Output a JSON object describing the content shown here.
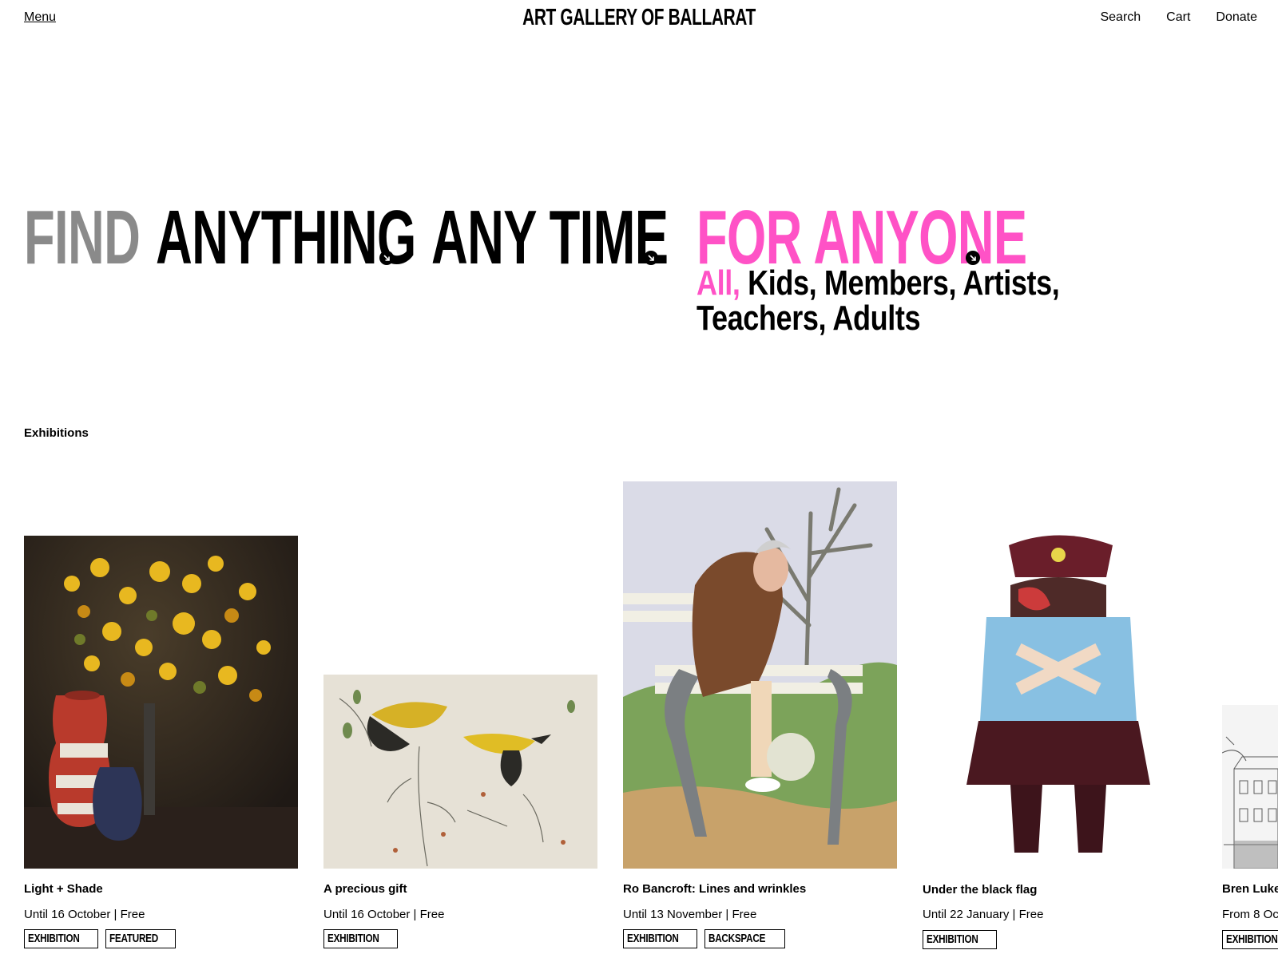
{
  "header": {
    "menu_label": "Menu",
    "site_title": "ART GALLERY OF BALLARAT",
    "nav": [
      "Search",
      "Cart",
      "Donate"
    ]
  },
  "hero": {
    "find": "FIND",
    "anything": "ANYTHING",
    "any_time": "ANY TIME",
    "for_anyone": "FOR ANYONE",
    "audiences": [
      "All,",
      "Kids,",
      "Members,",
      "Artists,",
      "Teachers,",
      "Adults"
    ],
    "accent_color": "#ff52c6",
    "muted_color": "#8a8a8a"
  },
  "exhibitions": {
    "section_label": "Exhibitions",
    "cards": [
      {
        "title": "Light + Shade",
        "meta": "Until 16 October | Free",
        "tags": [
          "EXHIBITION",
          "FEATURED"
        ]
      },
      {
        "title": "A precious gift",
        "meta": "Until 16 October | Free",
        "tags": [
          "EXHIBITION"
        ]
      },
      {
        "title": "Ro Bancroft: Lines and wrinkles",
        "meta": "Until 13 November | Free",
        "tags": [
          "EXHIBITION",
          "BACKSPACE"
        ]
      },
      {
        "title": "Under the black flag",
        "meta": "Until 22 January | Free",
        "tags": [
          "EXHIBITION"
        ]
      },
      {
        "title": "Bren Luke",
        "meta": "From 8 Oc",
        "tags": [
          "EXHIBITION"
        ]
      }
    ]
  }
}
